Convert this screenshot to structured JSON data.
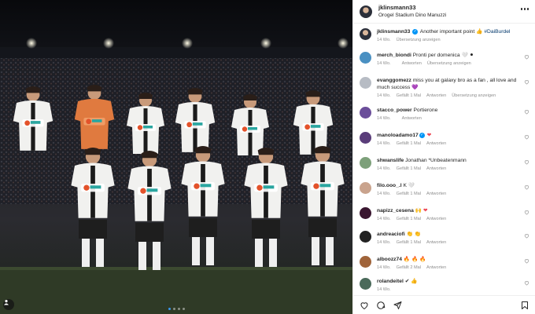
{
  "post": {
    "author": "jklinsmann33",
    "location": "Orogel Stadium Dino Manuzzi",
    "sponsor_text": "e-co",
    "sponsor_sub": "ENERGIA CORRENTE"
  },
  "caption": {
    "user": "jklinsmann33",
    "text": "Another important point",
    "hashtag": "#DaiBurdel",
    "time": "14 Wo.",
    "translate": "Übersetzung anzeigen"
  },
  "comments": [
    {
      "user": "merch_biondi",
      "text": "Pronti per domenica",
      "time": "14 Wo.",
      "likes": "",
      "reply": "Antworten",
      "translate": "Übersetzung anzeigen",
      "avatar_color": "#4a90c2"
    },
    {
      "user": "evanggomezz",
      "text": "miss you at galaxy bro as a fan , all love and much success",
      "time": "14 Wo.",
      "likes": "Gefällt 1 Mal",
      "reply": "Antworten",
      "translate": "Übersetzung anzeigen",
      "avatar_color": "#b7bcc4"
    },
    {
      "user": "stacco_power",
      "text": "Portierone",
      "time": "14 Wo.",
      "likes": "",
      "reply": "Antworten",
      "translate": "",
      "avatar_color": "#6b4e9a"
    },
    {
      "user": "manoloadamo17",
      "text": "",
      "time": "14 Wo.",
      "likes": "Gefällt 1 Mal",
      "reply": "Antworten",
      "translate": "",
      "avatar_color": "#5a3d7a"
    },
    {
      "user": "shwanslife",
      "text": "Jonathan *Unbeatenmann",
      "time": "14 Wo.",
      "likes": "Gefällt 1 Mal",
      "reply": "Antworten",
      "translate": "",
      "avatar_color": "#7da07a"
    },
    {
      "user": "filo.ooo_.l",
      "text": "K",
      "time": "14 Wo.",
      "likes": "Gefällt 1 Mal",
      "reply": "Antworten",
      "translate": "",
      "avatar_color": "#c9a38d"
    },
    {
      "user": "napizz_cesena",
      "text": "",
      "time": "14 Wo.",
      "likes": "Gefällt 1 Mal",
      "reply": "Antworten",
      "translate": "",
      "avatar_color": "#3a1630"
    },
    {
      "user": "andreaciofi",
      "text": "",
      "time": "14 Wo.",
      "likes": "Gefällt 1 Mal",
      "reply": "Antworten",
      "translate": "",
      "avatar_color": "#222222"
    },
    {
      "user": "alboozz74",
      "text": "",
      "time": "14 Wo.",
      "likes": "Gefällt 2 Mal",
      "reply": "Antworten",
      "translate": "",
      "avatar_color": "#a0643a"
    },
    {
      "user": "rolandeitel",
      "text": "",
      "time": "14 Wo.",
      "likes": "",
      "reply": "",
      "translate": "",
      "avatar_color": "#4a6a5a"
    }
  ],
  "colors": {
    "verified": "#0095f6",
    "hashtag": "#00376b",
    "meta": "#8e8e8e",
    "heart": "#ed4956"
  }
}
